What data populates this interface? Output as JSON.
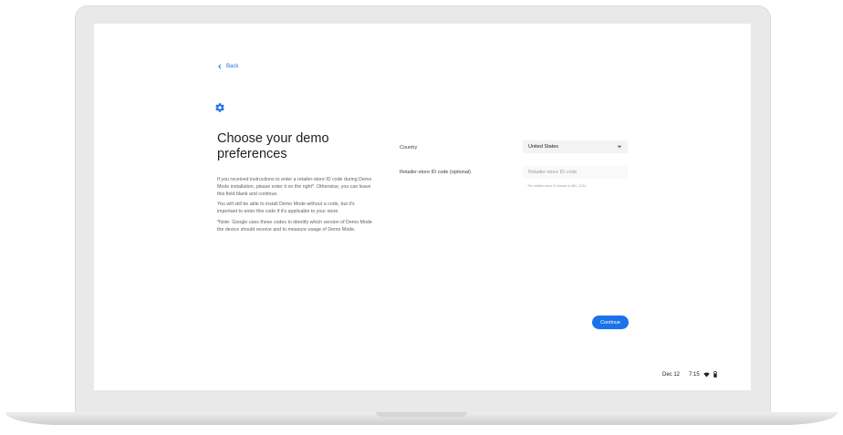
{
  "nav": {
    "back_label": "Back"
  },
  "icons": {
    "header": "gear-icon",
    "back": "chevron-left-icon",
    "dropdown": "chevron-down-icon",
    "wifi": "wifi-icon",
    "battery": "battery-icon"
  },
  "colors": {
    "accent": "#1a73e8",
    "title": "#202124",
    "body_text": "#5f6368",
    "field_bg": "#f1f3f4"
  },
  "page": {
    "title": "Choose your demo preferences",
    "paragraphs": [
      "If you received instructions to enter a retailer-store ID code during Demo Mode installation, please enter it on the right*. Otherwise, you can leave this field blank and continue.",
      "You will still be able to install Demo Mode without a code, but it's important to enter this code if it's applicable to your store.",
      "*Note: Google uses these codes to identify which version of Demo Mode the device should receive and to measure usage of Demo Mode."
    ]
  },
  "form": {
    "country_label": "Country",
    "country_value": "United States",
    "retailer_label": "Retailer-store ID code (optional)",
    "retailer_value": "",
    "retailer_placeholder": "Retailer-store ID code",
    "retailer_hint": "The retailer-store ID format is ABC-1234"
  },
  "actions": {
    "continue_label": "Continue"
  },
  "shelf": {
    "date": "Dec 12",
    "time": "7:15"
  }
}
